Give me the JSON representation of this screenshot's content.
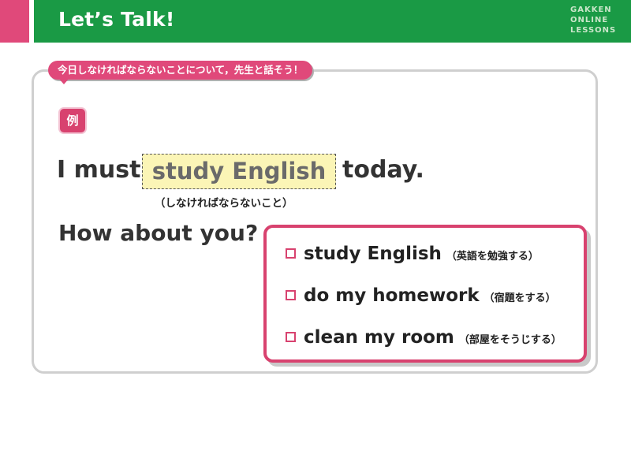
{
  "header": {
    "title": "Let’s Talk!",
    "brand_lines": [
      "GAKKEN",
      "ONLINE",
      "LESSONS"
    ]
  },
  "instruction": "今日しなければならないことについて，先生と話そう！",
  "example_badge": "例",
  "sentence": {
    "before": "I must",
    "answer": "study English",
    "after": "today.",
    "answer_note": "（しなければならないこと）"
  },
  "question": "How about you?",
  "options": [
    {
      "text": "study English",
      "note": "（英語を勉強する）"
    },
    {
      "text": "do my homework",
      "note": "（宿題をする）"
    },
    {
      "text": "clean my room",
      "note": "（部屋をそうじする）"
    }
  ],
  "colors": {
    "header_green": "#1a9a45",
    "accent_pink": "#e0497a",
    "answer_fill": "#fbf5b6"
  }
}
